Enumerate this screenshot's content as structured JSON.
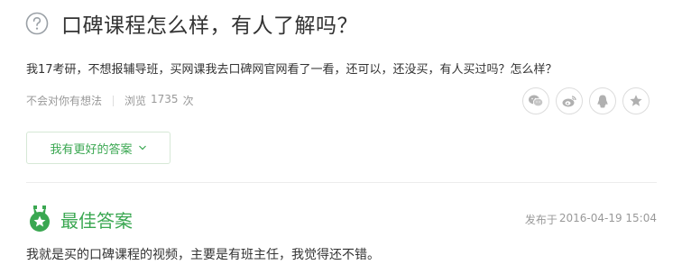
{
  "question": {
    "title": "口碑课程怎么样，有人了解吗？",
    "body": "我17考研，不想报辅导班，买网课我去口碑网官网看了一看，还可以，还没买，有人买过吗？怎么样？",
    "meta": {
      "no_idea_link": "不会对你有想法",
      "views_label": "浏览",
      "views_count": "1735",
      "views_unit": "次"
    },
    "share_icons": [
      "wechat-icon",
      "weibo-icon",
      "qq-icon",
      "favorite-star-icon"
    ]
  },
  "better_answer_button": "我有更好的答案",
  "best_answer": {
    "title": "最佳答案",
    "published_label": "发布于",
    "published_time": "2016-04-19 15:04",
    "content": "我就是买的口碑课程的视频，主要是有班主任，我觉得还不错。"
  },
  "colors": {
    "accent_green": "#3aa751",
    "meta_gray": "#999999",
    "text": "#333333"
  }
}
